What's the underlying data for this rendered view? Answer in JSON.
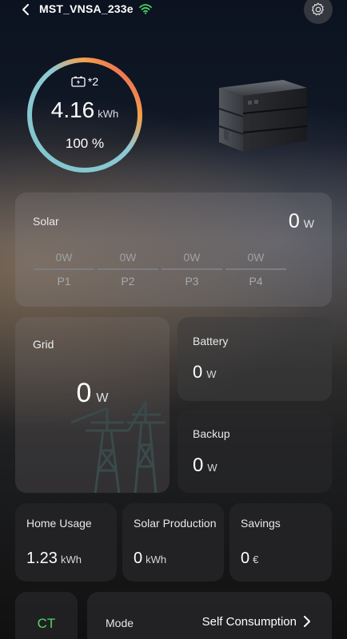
{
  "header": {
    "title": "MST_VNSA_233e"
  },
  "summary": {
    "battery_count": "*2",
    "energy_value": "4.16",
    "energy_unit": "kWh",
    "percent": "100 %"
  },
  "solar": {
    "label": "Solar",
    "value": "0",
    "unit": "W",
    "panels": [
      {
        "name": "P1",
        "power": "0W"
      },
      {
        "name": "P2",
        "power": "0W"
      },
      {
        "name": "P3",
        "power": "0W"
      },
      {
        "name": "P4",
        "power": "0W"
      }
    ]
  },
  "grid": {
    "label": "Grid",
    "value": "0",
    "unit": "W"
  },
  "battery": {
    "label": "Battery",
    "value": "0",
    "unit": "W"
  },
  "backup": {
    "label": "Backup",
    "value": "0",
    "unit": "W"
  },
  "stats": {
    "home_usage": {
      "label": "Home Usage",
      "value": "1.23",
      "unit": "kWh"
    },
    "solar_production": {
      "label": "Solar Production",
      "value": "0",
      "unit": "kWh"
    },
    "savings": {
      "label": "Savings",
      "value": "0",
      "unit": "€"
    }
  },
  "ct": {
    "label": "CT",
    "color": "#4fd36a"
  },
  "mode": {
    "label": "Mode",
    "value": "Self Consumption"
  },
  "colors": {
    "ring_start": "#7ec6cf",
    "ring_mid": "#f3a04a",
    "ring_end": "#e8475a",
    "wifi": "#4fd36a"
  }
}
